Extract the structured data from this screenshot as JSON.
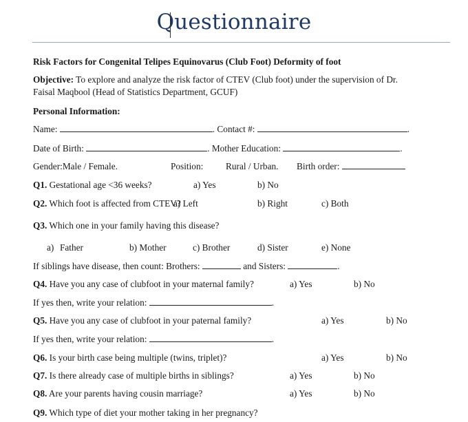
{
  "title": "Questionnaire",
  "subtitle": "Risk Factors for Congenital Telipes Equinovarus (Club Foot) Deformity of foot",
  "objective": {
    "label": "Objective:",
    "line1": " To explore and analyze the risk factor of CTEV (Club foot) under the supervision of Dr.",
    "line2": "Faisal Maqbool (Head of Statistics Department, GCUF)"
  },
  "personal": {
    "heading": "Personal Information:",
    "name_label": "Name:",
    "contact_label": ". Contact #:",
    "dob_label": "Date of Birth:",
    "mother_edu_label": ". Mother Education:",
    "gender": "Gender:Male / Female.",
    "position_label": "Position:",
    "position_options": "Rural / Urban.",
    "birth_order_label": "Birth order:",
    "period": "."
  },
  "questions": {
    "q1": {
      "num": "Q1.",
      "text": " Gestational age <36 weeks?",
      "a": "a) Yes",
      "b": "b) No"
    },
    "q2": {
      "num": "Q2.",
      "text": " Which foot is affected from CTEV?",
      "a": "a) Left",
      "b": "b) Right",
      "c": "c) Both"
    },
    "q3": {
      "num": "Q3.",
      "text": " Which one in your family having this disease?",
      "a": "a)",
      "a_val": "Father",
      "b": "b) Mother",
      "c": "c) Brother",
      "d": "d) Sister",
      "e": "e) None"
    },
    "siblings": {
      "text": "If siblings have disease, then count: Brothers:",
      "sisters": "and Sisters:"
    },
    "q4": {
      "num": "Q4.",
      "text": " Have you any case of clubfoot in your maternal family?",
      "a": "a) Yes",
      "b": "b) No"
    },
    "relation1": "If yes then, write your relation:",
    "q5": {
      "num": "Q5.",
      "text": " Have you any case of clubfoot in your paternal family?",
      "a": "a) Yes",
      "b": "b) No"
    },
    "relation2": "If yes then, write your relation:",
    "q6": {
      "num": "Q6.",
      "text": " Is your birth case being multiple (twins, triplet)?",
      "a": "a) Yes",
      "b": "b) No"
    },
    "q7": {
      "num": "Q7.",
      "text": " Is there already case of multiple births in siblings?",
      "a": "a) Yes",
      "b": "b) No"
    },
    "q8": {
      "num": "Q8.",
      "text": " Are your parents having cousin marriage?",
      "a": "a) Yes",
      "b": "b) No"
    },
    "q9": {
      "num": "Q9.",
      "text": " Which type of diet your mother taking in her pregnancy?"
    }
  }
}
